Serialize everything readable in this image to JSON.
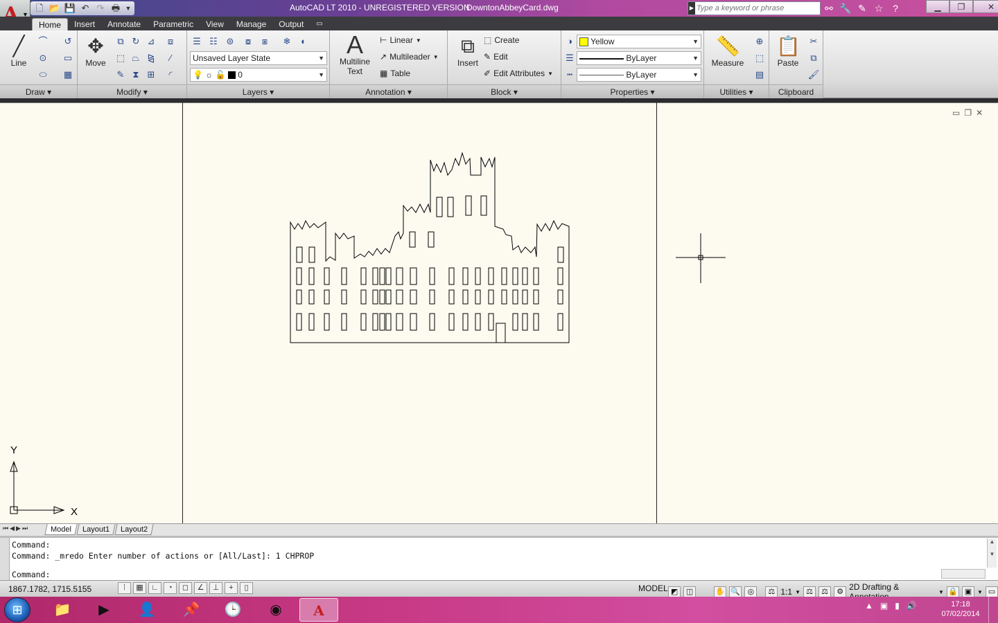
{
  "window": {
    "title": "AutoCAD LT 2010 - UNREGISTERED VERSION",
    "file": "DowntonAbbeyCard.dwg",
    "search_placeholder": "Type a keyword or phrase"
  },
  "tabs": [
    "Home",
    "Insert",
    "Annotate",
    "Parametric",
    "View",
    "Manage",
    "Output"
  ],
  "ribbon": {
    "draw": {
      "label": "Draw",
      "line": "Line"
    },
    "modify": {
      "label": "Modify",
      "move": "Move"
    },
    "layers": {
      "label": "Layers",
      "layer_state": "Unsaved Layer State",
      "current_layer": "0"
    },
    "annotation": {
      "label": "Annotation",
      "multiline": "Multiline",
      "text": "Text",
      "linear": "Linear",
      "multileader": "Multileader",
      "table": "Table"
    },
    "block": {
      "label": "Block",
      "insert": "Insert",
      "create": "Create",
      "edit": "Edit",
      "edit_attributes": "Edit Attributes"
    },
    "properties": {
      "label": "Properties",
      "color": "Yellow",
      "linetype": "ByLayer",
      "lineweight": "ByLayer",
      "color_hex": "#ffff00"
    },
    "utilities": {
      "label": "Utilities",
      "measure": "Measure"
    },
    "clipboard": {
      "label": "Clipboard",
      "paste": "Paste"
    }
  },
  "ucs": {
    "x": "X",
    "y": "Y"
  },
  "layout_tabs": [
    "Model",
    "Layout1",
    "Layout2"
  ],
  "command": {
    "line1": "Command:",
    "line2": "Command: _mredo Enter number of actions or [All/Last]: 1 CHPROP",
    "prompt": "Command:"
  },
  "status": {
    "coords": "1867.1782, 1715.5155",
    "model": "MODEL",
    "scale": "1:1",
    "workspace": "2D Drafting & Annotation"
  },
  "clock": {
    "time": "17:18",
    "date": "07/02/2014"
  }
}
